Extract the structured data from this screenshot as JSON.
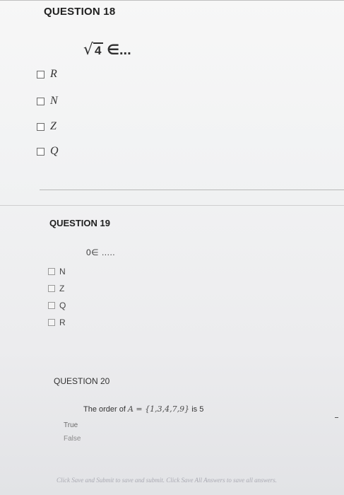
{
  "q18": {
    "heading": "QUESTION 18",
    "prompt_radicand": "4",
    "prompt_rest": "∈...",
    "options": [
      "R",
      "N",
      "Z",
      "Q"
    ]
  },
  "q19": {
    "heading": "QUESTION 19",
    "prompt": "0∈ .....",
    "options": [
      "N",
      "Z",
      "Q",
      "R"
    ]
  },
  "q20": {
    "heading": "QUESTION 20",
    "prompt_prefix": "The order of",
    "prompt_set": "A = {1,3,4,7,9}",
    "prompt_suffix": "is 5",
    "options": [
      "True",
      "False"
    ]
  },
  "footer": {
    "text": "Click Save and Submit to save and submit. Click Save All Answers to save all answers."
  }
}
